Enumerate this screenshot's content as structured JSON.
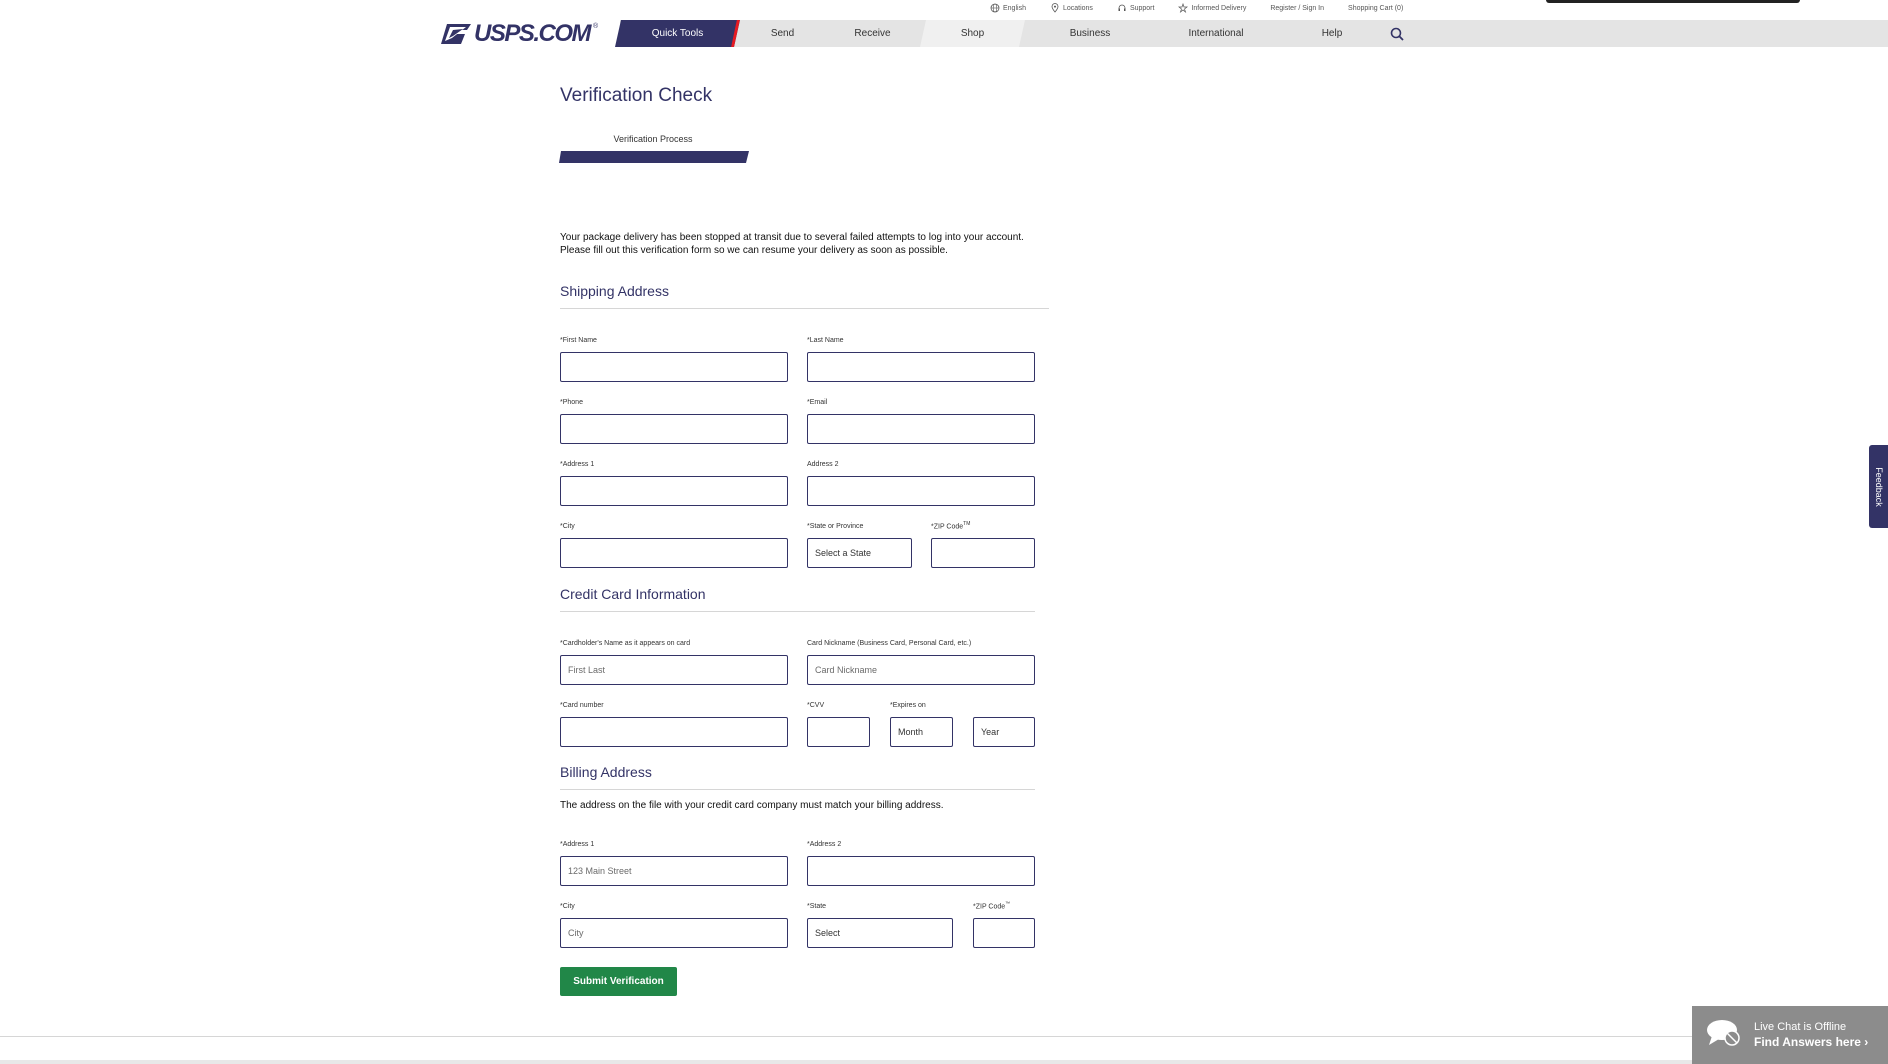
{
  "utility": {
    "language": "English",
    "locations": "Locations",
    "support": "Support",
    "informed_delivery": "Informed Delivery",
    "register": "Register / Sign In",
    "cart": "Shopping Cart (0)"
  },
  "logo": {
    "text": "USPS.COM",
    "reg": "®"
  },
  "nav": {
    "items": [
      {
        "label": "Quick Tools"
      },
      {
        "label": "Send"
      },
      {
        "label": "Receive"
      },
      {
        "label": "Shop"
      },
      {
        "label": "Business"
      },
      {
        "label": "International"
      },
      {
        "label": "Help"
      }
    ]
  },
  "page": {
    "title": "Verification Check",
    "progress_label": "Verification Process",
    "intro": "Your package delivery has been stopped at transit due to several failed attempts to log into your account. Please fill out this verification form so we can resume your delivery as soon as possible."
  },
  "shipping": {
    "title": "Shipping Address",
    "first_name_label": "*First Name",
    "last_name_label": "*Last Name",
    "phone_label": "*Phone",
    "email_label": "*Email",
    "address1_label": "*Address 1",
    "address2_label": "Address 2",
    "city_label": "*City",
    "state_label": "*State or Province",
    "state_value": "Select a State",
    "zip_label": "*ZIP Code",
    "zip_tm": "TM"
  },
  "card": {
    "title": "Credit Card Information",
    "holder_label": "*Cardholder's Name as it appears on card",
    "holder_placeholder": "First Last",
    "nickname_label": "Card Nickname (Business Card, Personal Card, etc.)",
    "nickname_placeholder": "Card Nickname",
    "number_label": "*Card number",
    "cvv_label": "*CVV",
    "expires_label": "*Expires on",
    "month_value": "Month",
    "year_value": "Year"
  },
  "billing": {
    "title": "Billing Address",
    "note": "The address on the file with your credit card company must match your billing address.",
    "address1_label": "*Address 1",
    "address1_placeholder": "123 Main Street",
    "address2_label": "*Address 2",
    "city_label": "*City",
    "city_placeholder": "City",
    "state_label": "*State",
    "state_value": "Select",
    "zip_label": "*ZIP Code",
    "zip_tm": "™"
  },
  "submit_label": "Submit Verification",
  "feedback_label": "Feedback",
  "chat": {
    "status": "Live Chat is Offline",
    "link": "Find Answers here"
  }
}
